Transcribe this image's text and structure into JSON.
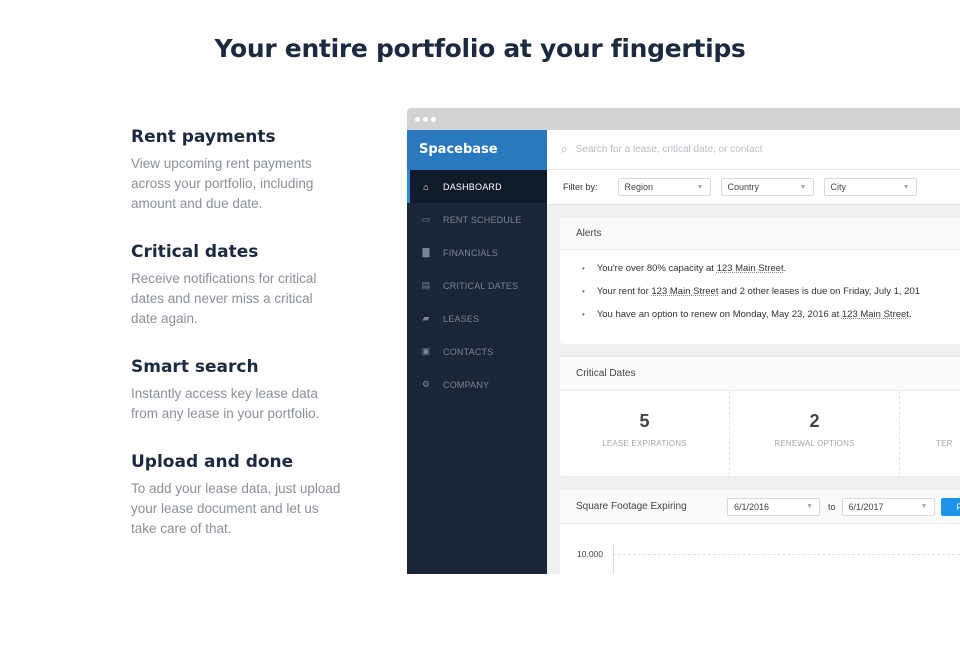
{
  "hero_title": "Your entire portfolio at your fingertips",
  "features": [
    {
      "title": "Rent payments",
      "text": "View upcoming rent payments across your portfolio, including amount and due date."
    },
    {
      "title": "Critical dates",
      "text": "Receive notifications for critical dates and never miss a critical date again."
    },
    {
      "title": "Smart search",
      "text": "Instantly access key lease data from any lease in your portfolio."
    },
    {
      "title": "Upload and done",
      "text": "To add your lease data, just upload your lease document and let us take care of that."
    }
  ],
  "app": {
    "brand": "Spacebase",
    "accent": "#2a78bd",
    "sidebar": [
      {
        "label": "DASHBOARD",
        "icon": "home-icon",
        "active": true
      },
      {
        "label": "RENT SCHEDULE",
        "icon": "credit-card-icon"
      },
      {
        "label": "FINANCIALS",
        "icon": "bar-chart-icon"
      },
      {
        "label": "CRITICAL DATES",
        "icon": "calendar-icon"
      },
      {
        "label": "LEASES",
        "icon": "folder-icon"
      },
      {
        "label": "CONTACTS",
        "icon": "contact-card-icon"
      },
      {
        "label": "COMPANY",
        "icon": "gear-icon"
      }
    ],
    "search_placeholder": "Search for a lease, critical date, or contact",
    "filter_label": "Filter by:",
    "filters": [
      "Region",
      "Country",
      "City"
    ],
    "alerts": {
      "title": "Alerts",
      "items": [
        {
          "pre": "You're over 80% capacity at ",
          "link": "123 Main Street",
          "post": "."
        },
        {
          "pre": "Your rent for ",
          "link": "123 Main Street",
          "post": " and 2 other leases is due on Friday, July 1, 201"
        },
        {
          "pre": "You have an option to renew on Monday, May 23, 2016 at ",
          "link": "123 Main Street",
          "post": "."
        }
      ]
    },
    "critical_dates": {
      "title": "Critical Dates",
      "tiles": [
        {
          "value": "5",
          "label": "LEASE EXPIRATIONS"
        },
        {
          "value": "2",
          "label": "RENEWAL OPTIONS"
        },
        {
          "value": "",
          "label": "TER"
        }
      ]
    },
    "sqft": {
      "title": "Square Footage Expiring",
      "from": "6/1/2016",
      "to_label": "to",
      "to": "6/1/2017",
      "button": "F",
      "y_tick": "10,000"
    }
  }
}
